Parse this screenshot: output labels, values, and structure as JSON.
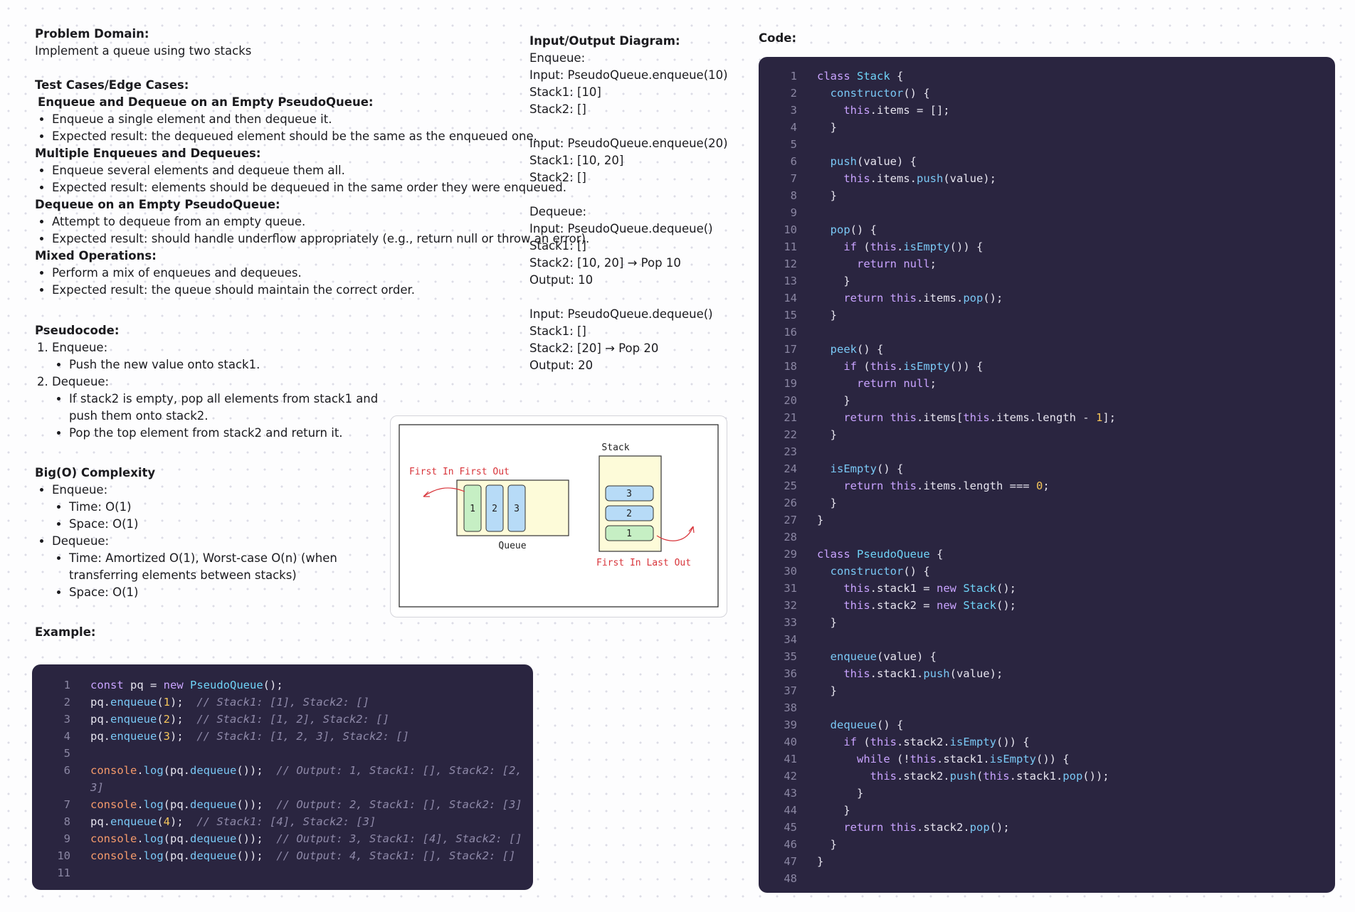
{
  "problem": {
    "heading": "Problem Domain:",
    "text": "Implement a queue using two stacks"
  },
  "tests": {
    "heading": "Test Cases/Edge Cases:",
    "groups": [
      {
        "title": "Enqueue and Dequeue on an Empty PseudoQueue:",
        "items": [
          "Enqueue a single element and then dequeue it.",
          "Expected result: the dequeued element should be the same as the enqueued one."
        ]
      },
      {
        "title": "Multiple Enqueues and Dequeues:",
        "items": [
          "Enqueue several elements and dequeue them all.",
          "Expected result: elements should be dequeued in the same order they were enqueued."
        ]
      },
      {
        "title": "Dequeue on an Empty PseudoQueue:",
        "items": [
          "Attempt to dequeue from an empty queue.",
          "Expected result: should handle underflow appropriately (e.g., return null or throw an error)."
        ]
      },
      {
        "title": "Mixed Operations:",
        "items": [
          "Perform a mix of enqueues and dequeues.",
          "Expected result: the queue should maintain the correct order."
        ]
      }
    ]
  },
  "pseudocode": {
    "heading": "Pseudocode:",
    "step1": "Enqueue:",
    "step1_items": [
      "Push the new value onto stack1."
    ],
    "step2": "Dequeue:",
    "step2_items": [
      "If stack2 is empty, pop all elements from stack1 and",
      "push them onto stack2.",
      "Pop the top element from stack2 and return it."
    ]
  },
  "bigo": {
    "heading": "Big(O) Complexity",
    "enqueue": "Enqueue:",
    "enqueue_time": "Time: O(1)",
    "enqueue_space": "Space: O(1)",
    "dequeue": "Dequeue:",
    "dequeue_time_1": "Time: Amortized O(1), Worst-case O(n) (when",
    "dequeue_time_2": "transferring elements between stacks)",
    "dequeue_space": "Space: O(1)"
  },
  "example": {
    "heading": "Example:"
  },
  "io": {
    "heading": "Input/Output Diagram:",
    "lines": [
      "Enqueue:",
      "Input: PseudoQueue.enqueue(10)",
      "Stack1: [10]",
      "Stack2: []",
      "",
      "Input: PseudoQueue.enqueue(20)",
      "Stack1: [10, 20]",
      "Stack2: []",
      "",
      "Dequeue:",
      "Input: PseudoQueue.dequeue()",
      "Stack1: []",
      "Stack2: [10, 20] → Pop 10",
      "Output: 10",
      "",
      "Input: PseudoQueue.dequeue()",
      "Stack1: []",
      "Stack2: [20] → Pop 20",
      "Output: 20"
    ]
  },
  "diagram": {
    "fifo_label": "First In First Out",
    "queue_label": "Queue",
    "queue_items": [
      "1",
      "2",
      "3"
    ],
    "stack_title": "Stack",
    "stack_items": [
      "3",
      "2",
      "1"
    ],
    "lifo_label": "First In Last Out"
  },
  "code": {
    "heading": "Code:"
  },
  "colors": {
    "code_bg": "#2a2540",
    "keyword": "#c9a3ff",
    "class_name": "#6fd3f7",
    "number": "#f5c55a",
    "comment": "#8e89a8",
    "diagram_red": "#d8343a",
    "green_block": "#c6efc4",
    "blue_block": "#b7dbf7",
    "yellow_box": "#fdfbd9"
  }
}
